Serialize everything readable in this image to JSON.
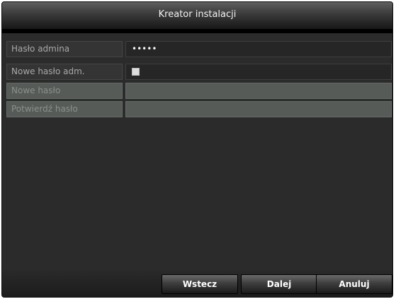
{
  "window": {
    "title": "Kreator instalacji"
  },
  "form": {
    "admin_password": {
      "label": "Hasło admina",
      "value": "•••••"
    },
    "new_admin_password": {
      "label": "Nowe hasło adm."
    },
    "new_password": {
      "label": "Nowe hasło"
    },
    "confirm_password": {
      "label": "Potwierdź hasło"
    }
  },
  "buttons": {
    "back": "Wstecz",
    "next": "Dalej",
    "cancel": "Anuluj"
  }
}
